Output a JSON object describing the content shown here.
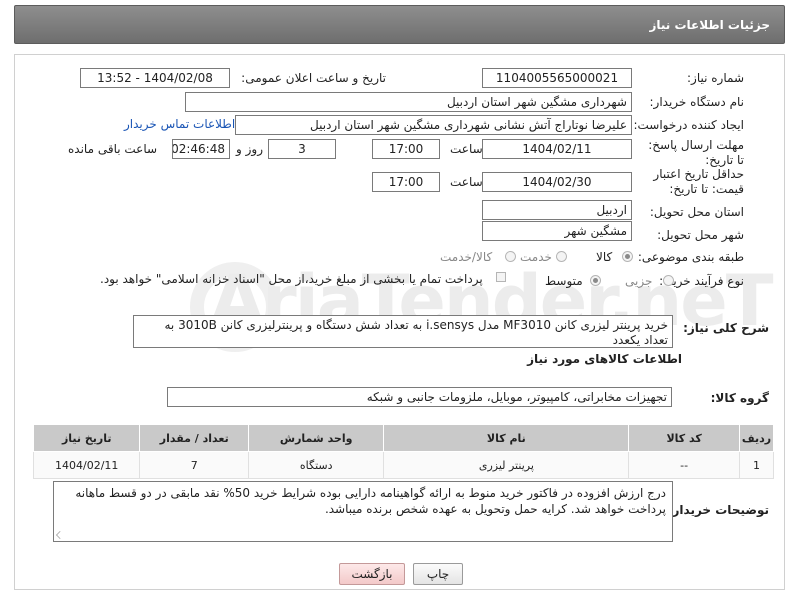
{
  "header": {
    "title": "جزئیات اطلاعات نیاز"
  },
  "watermark": {
    "text": "AriaTender.neT"
  },
  "form": {
    "need_number": {
      "label": "شماره نیاز:",
      "value": "1104005565000021"
    },
    "announce_datetime": {
      "label": "تاریخ و ساعت اعلان عمومی:",
      "value": "1404/02/08 - 13:52"
    },
    "buyer_org": {
      "label": "نام دستگاه خریدار:",
      "value": "شهرداری مشگین شهر استان اردبیل"
    },
    "requester": {
      "label": "ایجاد کننده درخواست:",
      "value": "علیرضا نوتاراج آتش نشانی شهرداری مشگین شهر استان اردبیل",
      "contact_link": "اطلاعات تماس خریدار"
    },
    "deadline": {
      "label": "مهلت ارسال پاسخ: تا تاریخ:",
      "date": "1404/02/11",
      "time_label": "ساعت",
      "time": "17:00",
      "days": "3",
      "days_label": "روز و",
      "remaining": "02:46:48",
      "remaining_label": "ساعت باقی مانده"
    },
    "price_validity": {
      "label": "حداقل تاریخ اعتبار قیمت: تا تاریخ:",
      "date": "1404/02/30",
      "time_label": "ساعت",
      "time": "17:00"
    },
    "delivery_province": {
      "label": "استان محل تحویل:",
      "value": "اردبیل"
    },
    "delivery_city": {
      "label": "شهر محل تحویل:",
      "value": "مشگین شهر"
    },
    "category": {
      "label": "طبقه بندی موضوعی:",
      "options": [
        "کالا",
        "خدمت",
        "کالا/خدمت"
      ],
      "selected": "کالا"
    },
    "process_type": {
      "label": "نوع فرآیند خرید :",
      "options": [
        "جزیی",
        "متوسط"
      ],
      "selected": "متوسط",
      "payment_note": "پرداخت تمام یا بخشی از مبلغ خرید،از محل \"اسناد خزانه اسلامی\" خواهد بود."
    },
    "general_description": {
      "label": "شرح کلی نیاز:",
      "value": "خرید پرینتر لیزری کانن MF3010 مدل i.sensys به تعداد شش دستگاه و پرینترلیزری کانن 3010B به تعداد یکعدد"
    },
    "goods_info_title": "اطلاعات کالاهای مورد نیاز",
    "goods_group": {
      "label": "گروه کالا:",
      "value": "تجهیزات مخابراتی، کامپیوتر، موبایل، ملزومات جانبی و شبکه"
    }
  },
  "table": {
    "headers": [
      "ردیف",
      "کد کالا",
      "نام کالا",
      "واحد شمارش",
      "تعداد / مقدار",
      "تاریخ نیاز"
    ],
    "rows": [
      [
        "1",
        "--",
        "پرینتر لیزری",
        "دستگاه",
        "7",
        "1404/02/11"
      ]
    ]
  },
  "buyer_notes": {
    "label": "توضیحات خریدار:",
    "value": "درج ارزش افزوده در فاکتور خرید منوط به ارائه گواهینامه دارایی بوده شرایط خرید 50% نقد مابقی در دو قسط ماهانه پرداخت خواهد شد. کرایه حمل وتحویل به عهده شخص برنده میباشد."
  },
  "buttons": {
    "print": "چاپ",
    "back": "بازگشت"
  }
}
